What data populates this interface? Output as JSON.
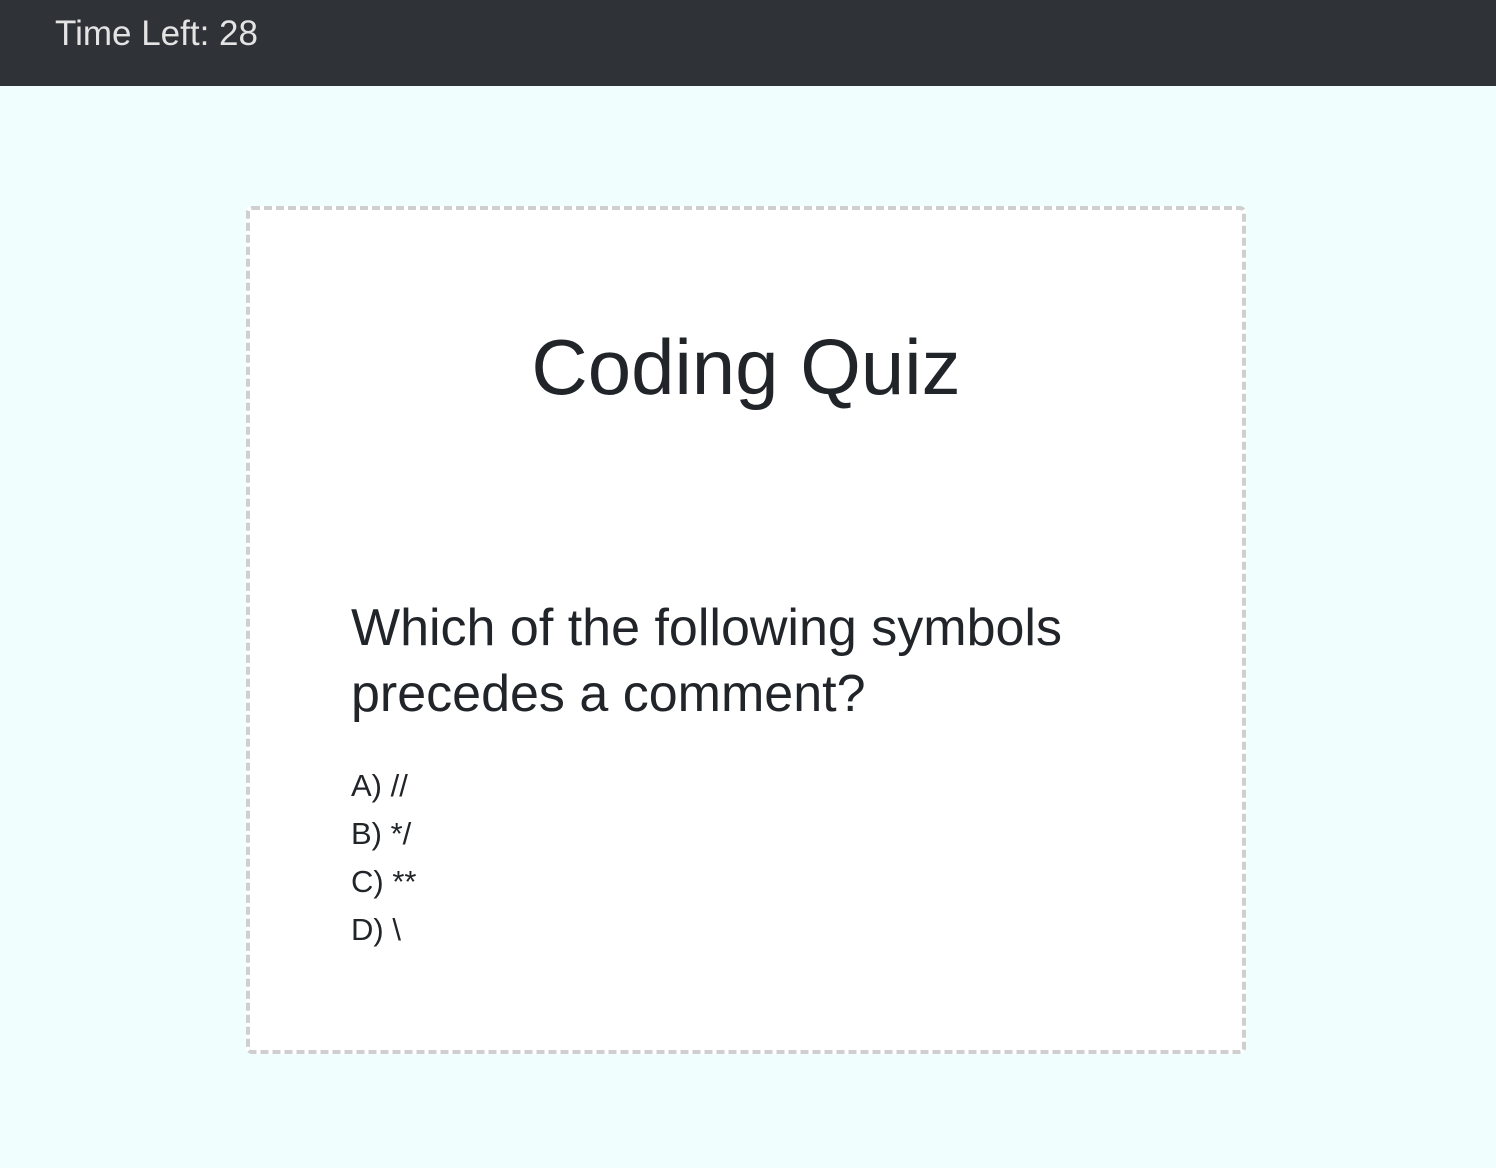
{
  "navbar": {
    "timer_text": "Time Left: 28"
  },
  "quiz": {
    "title": "Coding Quiz",
    "question": "Which of the following symbols precedes a comment?",
    "answers": [
      {
        "label": "A) //"
      },
      {
        "label": "B) */"
      },
      {
        "label": "C) **"
      },
      {
        "label": "D) \\"
      }
    ]
  },
  "colors": {
    "navbar_background": "#2f3338",
    "page_background": "#f0fffe",
    "card_background": "#ffffff",
    "card_border": "#cfcfcf",
    "text": "#212529",
    "timer_text": "#e4e4e4"
  }
}
